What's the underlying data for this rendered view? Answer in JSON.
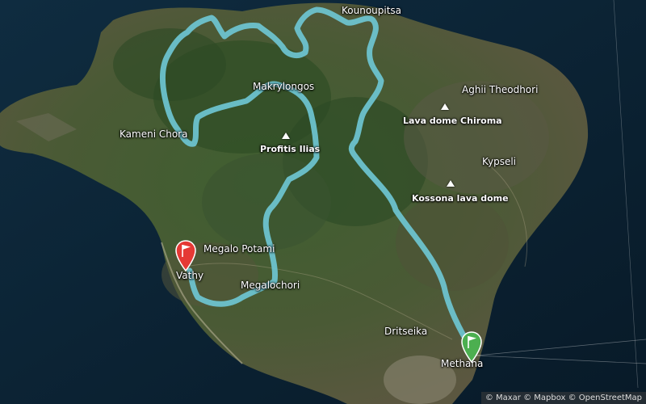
{
  "places": {
    "kounoupitsa": "Kounoupitsa",
    "makrylongos": "Makrylongos",
    "aghii_theodhori": "Aghii Theodhori",
    "kameni_chora": "Kameni Chora",
    "kypseli": "Kypseli",
    "megalo_potami": "Megalo Potami",
    "vathy": "Vathy",
    "megalochori": "Megalochori",
    "dritseika": "Dritseika",
    "methana": "Methana"
  },
  "peaks": {
    "lava_dome_chiroma": "Lava dome Chiroma",
    "profitis_ilias": "Profitis Ilias",
    "kossona_lava_dome": "Kossona lava dome"
  },
  "markers": {
    "start": {
      "color": "#4caf50",
      "icon": "flag-icon"
    },
    "end": {
      "color": "#e53935",
      "icon": "flag-icon"
    }
  },
  "route": {
    "color": "#6ec6d2"
  },
  "attribution": "© Maxar © Mapbox © OpenStreetMap"
}
